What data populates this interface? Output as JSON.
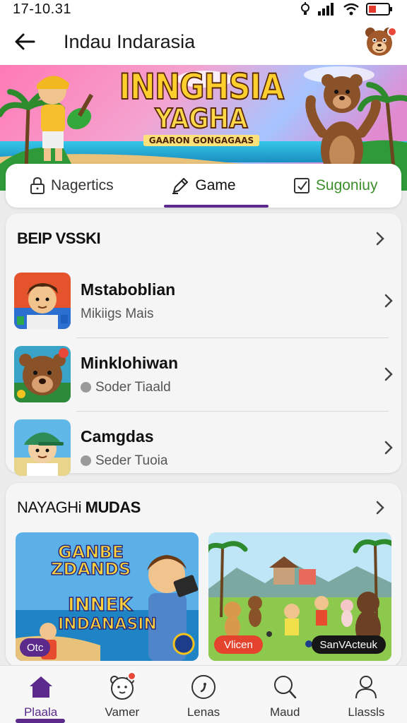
{
  "status_bar": {
    "time": "17-10.31"
  },
  "app_bar": {
    "title": "Indau Indarasia"
  },
  "banner": {
    "line1": "INNGHSIA",
    "line2": "YAGHA",
    "subtitle": "GAARON GONGAGAAS"
  },
  "tabs": [
    {
      "label": "Nagertics",
      "icon": "lock-icon"
    },
    {
      "label": "Game",
      "icon": "pen-icon",
      "active": true
    },
    {
      "label": "Sugoniuy",
      "icon": "checkbox-icon",
      "color": "#3d8f2b"
    }
  ],
  "section1": {
    "title": "BEIP VSSKI",
    "items": [
      {
        "title": "Mstaboblian",
        "subtitle": "Mikiigs Mais",
        "has_dot": false
      },
      {
        "title": "Minklohiwan",
        "subtitle": "Soder Tiaald",
        "has_dot": true
      },
      {
        "title": "Camgdas",
        "subtitle": "Seder Tuoia",
        "has_dot": true
      }
    ]
  },
  "section2": {
    "title_light": "NAYAGHi",
    "title_bold": "MUDAS",
    "tiles": [
      {
        "text1": "GANBE",
        "text2": "ZDANDS",
        "text3": "INNEK",
        "text4": "INDANASIN",
        "badge": "Otc"
      },
      {
        "badge_left": "Vlicen",
        "badge_right": "SanVActeuk"
      }
    ]
  },
  "bottom_nav": [
    {
      "label": "Plaala",
      "icon": "home-icon",
      "active": true
    },
    {
      "label": "Vamer",
      "icon": "bear-face-icon",
      "badge": true
    },
    {
      "label": "Lenas",
      "icon": "comma-circle-icon"
    },
    {
      "label": "Maud",
      "icon": "search-icon"
    },
    {
      "label": "Llassls",
      "icon": "person-icon"
    }
  ],
  "colors": {
    "accent": "#5b2a8c",
    "badge": "#e8473a",
    "green": "#3d8f2b"
  }
}
